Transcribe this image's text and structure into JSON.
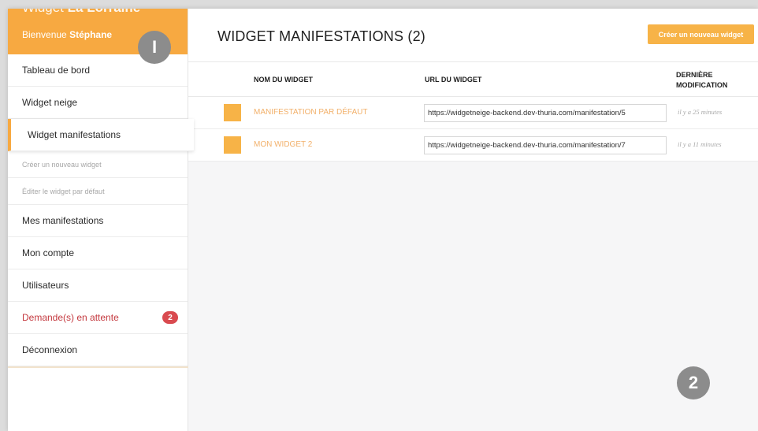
{
  "sidebar": {
    "brand_prefix": "Widget",
    "brand_name": "La Lorraine",
    "welcome_prefix": "Bienvenue",
    "user_name": "Stéphane",
    "items": [
      {
        "label": "Tableau de bord"
      },
      {
        "label": "Widget neige"
      },
      {
        "label": "Widget manifestations"
      },
      {
        "label": "Créer un nouveau widget"
      },
      {
        "label": "Éditer le widget par défaut"
      },
      {
        "label": "Mes manifestations"
      },
      {
        "label": "Mon compte"
      },
      {
        "label": "Utilisateurs"
      },
      {
        "label": "Demande(s) en attente",
        "badge": "2"
      },
      {
        "label": "Déconnexion"
      }
    ]
  },
  "main": {
    "title": "WIDGET MANIFESTATIONS (2)",
    "create_button": "Créer un nouveau widget",
    "columns": {
      "name": "NOM DU WIDGET",
      "url": "URL DU WIDGET",
      "modified_line1": "DERNIÈRE",
      "modified_line2": "MODIFICATION"
    },
    "rows": [
      {
        "name": "MANIFESTATION PAR DÉFAUT",
        "url": "https://widgetneige-backend.dev-thuria.com/manifestation/5",
        "modified": "il y a 25 minutes"
      },
      {
        "name": "MON WIDGET 2",
        "url": "https://widgetneige-backend.dev-thuria.com/manifestation/7",
        "modified": "il y a 11 minutes"
      }
    ]
  },
  "markers": {
    "one": "I",
    "two": "2"
  },
  "colors": {
    "accent": "#f7a941",
    "alert": "#d94a4f",
    "marker": "#8c8c8c"
  }
}
